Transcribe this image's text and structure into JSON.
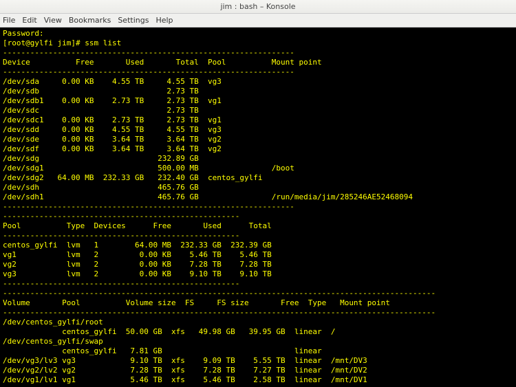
{
  "window": {
    "title": "jim : bash – Konsole"
  },
  "menu": {
    "file": "File",
    "edit": "Edit",
    "view": "View",
    "bookmarks": "Bookmarks",
    "settings": "Settings",
    "help": "Help"
  },
  "prompt_password": "Password:",
  "prompt": "[root@gylfi jim]# ",
  "command": "ssm list",
  "sep": "----------------------------------------------------------------",
  "sep2": "------------------------------------------------------------------------",
  "sep3": "----------------------------------------------------",
  "sep4": "-----------------------------------------------------------------------------------------------",
  "devices_header": {
    "device": "Device",
    "free": "Free",
    "used": "Used",
    "total": "Total",
    "pool": "Pool",
    "mount": "Mount point"
  },
  "devices": [
    {
      "dev": "/dev/sda",
      "free": "0.00 KB",
      "used": "4.55 TB",
      "total": "4.55 TB",
      "pool": "vg3",
      "mount": ""
    },
    {
      "dev": "/dev/sdb",
      "free": "",
      "used": "",
      "total": "2.73 TB",
      "pool": "",
      "mount": ""
    },
    {
      "dev": "/dev/sdb1",
      "free": "0.00 KB",
      "used": "2.73 TB",
      "total": "2.73 TB",
      "pool": "vg1",
      "mount": ""
    },
    {
      "dev": "/dev/sdc",
      "free": "",
      "used": "",
      "total": "2.73 TB",
      "pool": "",
      "mount": ""
    },
    {
      "dev": "/dev/sdc1",
      "free": "0.00 KB",
      "used": "2.73 TB",
      "total": "2.73 TB",
      "pool": "vg1",
      "mount": ""
    },
    {
      "dev": "/dev/sdd",
      "free": "0.00 KB",
      "used": "4.55 TB",
      "total": "4.55 TB",
      "pool": "vg3",
      "mount": ""
    },
    {
      "dev": "/dev/sde",
      "free": "0.00 KB",
      "used": "3.64 TB",
      "total": "3.64 TB",
      "pool": "vg2",
      "mount": ""
    },
    {
      "dev": "/dev/sdf",
      "free": "0.00 KB",
      "used": "3.64 TB",
      "total": "3.64 TB",
      "pool": "vg2",
      "mount": ""
    },
    {
      "dev": "/dev/sdg",
      "free": "",
      "used": "",
      "total": "232.89 GB",
      "pool": "",
      "mount": ""
    },
    {
      "dev": "/dev/sdg1",
      "free": "",
      "used": "",
      "total": "500.00 MB",
      "pool": "",
      "mount": "/boot"
    },
    {
      "dev": "/dev/sdg2",
      "free": "64.00 MB",
      "used": "232.33 GB",
      "total": "232.40 GB",
      "pool": "centos_gylfi",
      "mount": ""
    },
    {
      "dev": "/dev/sdh",
      "free": "",
      "used": "",
      "total": "465.76 GB",
      "pool": "",
      "mount": ""
    },
    {
      "dev": "/dev/sdh1",
      "free": "",
      "used": "",
      "total": "465.76 GB",
      "pool": "",
      "mount": "/run/media/jim/285246AE52468094"
    }
  ],
  "pools_header": {
    "pool": "Pool",
    "type": "Type",
    "devices": "Devices",
    "free": "Free",
    "used": "Used",
    "total": "Total"
  },
  "pools": [
    {
      "pool": "centos_gylfi",
      "type": "lvm",
      "devices": "1",
      "free": "64.00 MB",
      "used": "232.33 GB",
      "total": "232.39 GB"
    },
    {
      "pool": "vg1",
      "type": "lvm",
      "devices": "2",
      "free": "0.00 KB",
      "used": "5.46 TB",
      "total": "5.46 TB"
    },
    {
      "pool": "vg2",
      "type": "lvm",
      "devices": "2",
      "free": "0.00 KB",
      "used": "7.28 TB",
      "total": "7.28 TB"
    },
    {
      "pool": "vg3",
      "type": "lvm",
      "devices": "2",
      "free": "0.00 KB",
      "used": "9.10 TB",
      "total": "9.10 TB"
    }
  ],
  "volumes_header": {
    "volume": "Volume",
    "pool": "Pool",
    "size": "Volume size",
    "fs": "FS",
    "fssize": "FS size",
    "free": "Free",
    "type": "Type",
    "mount": "Mount point"
  },
  "volumes": [
    {
      "vol": "/dev/centos_gylfi/root",
      "pool": "centos_gylfi",
      "size": "50.00 GB",
      "fs": "xfs",
      "fssize": "49.98 GB",
      "free": "39.95 GB",
      "type": "linear",
      "mount": "/"
    },
    {
      "vol": "/dev/centos_gylfi/swap",
      "pool": "centos_gylfi",
      "size": "7.81 GB",
      "fs": "",
      "fssize": "",
      "free": "",
      "type": "linear",
      "mount": ""
    },
    {
      "vol": "/dev/vg3/lv3",
      "pool": "vg3",
      "size": "9.10 TB",
      "fs": "xfs",
      "fssize": "9.09 TB",
      "free": "5.55 TB",
      "type": "linear",
      "mount": "/mnt/DV3"
    },
    {
      "vol": "/dev/vg2/lv2",
      "pool": "vg2",
      "size": "7.28 TB",
      "fs": "xfs",
      "fssize": "7.28 TB",
      "free": "7.27 TB",
      "type": "linear",
      "mount": "/mnt/DV2"
    },
    {
      "vol": "/dev/vg1/lv1",
      "pool": "vg1",
      "size": "5.46 TB",
      "fs": "xfs",
      "fssize": "5.46 TB",
      "free": "2.58 TB",
      "type": "linear",
      "mount": "/mnt/DV1"
    }
  ]
}
